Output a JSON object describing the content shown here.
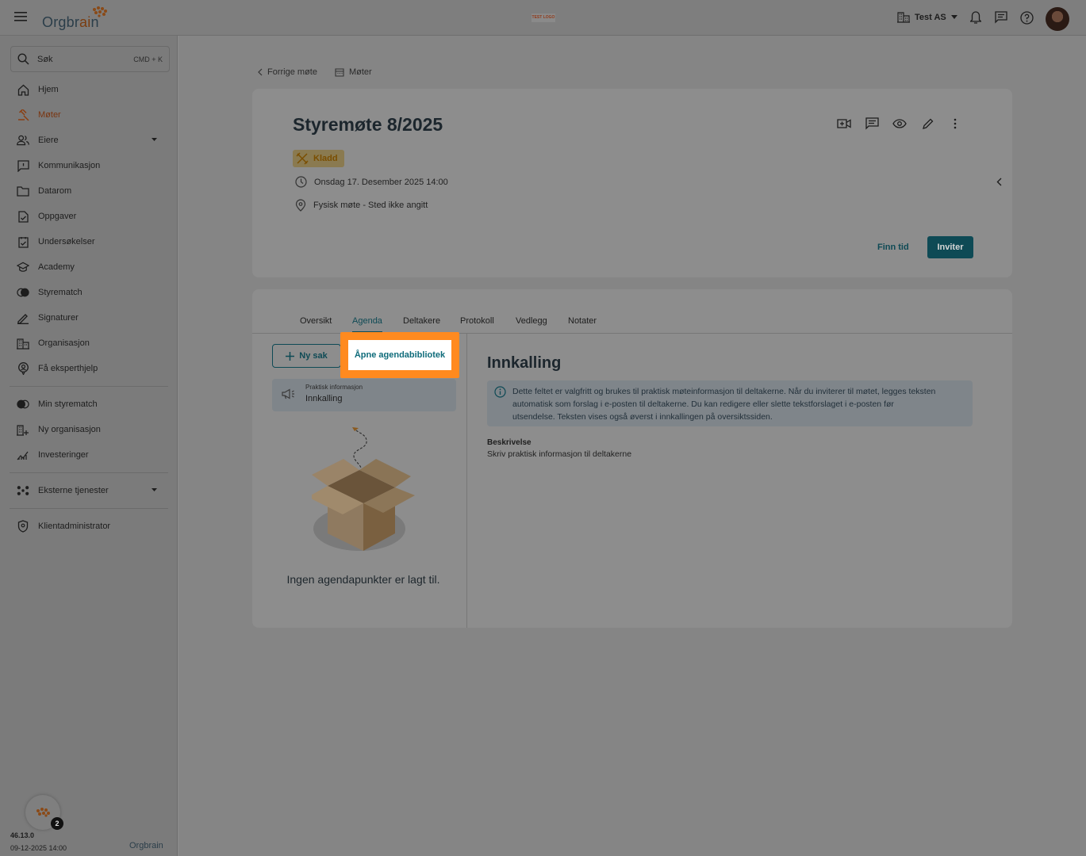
{
  "app": {
    "brand": "Orgbrain",
    "brand_left": "Orgbr",
    "brand_accent": "ai",
    "brand_right": "n",
    "test_logo": "TEST LOGO",
    "org_name": "Test AS"
  },
  "search": {
    "label": "Søk",
    "shortcut": "CMD + K"
  },
  "nav": {
    "items": [
      {
        "label": "Hjem",
        "icon": "home-icon"
      },
      {
        "label": "Møter",
        "icon": "gavel-icon"
      },
      {
        "label": "Eiere",
        "icon": "people-icon"
      },
      {
        "label": "Kommunikasjon",
        "icon": "chat-icon"
      },
      {
        "label": "Datarom",
        "icon": "folder-icon"
      },
      {
        "label": "Oppgaver",
        "icon": "task-icon"
      },
      {
        "label": "Undersøkelser",
        "icon": "survey-icon"
      },
      {
        "label": "Academy",
        "icon": "graduation-icon"
      },
      {
        "label": "Styrematch",
        "icon": "match-icon"
      },
      {
        "label": "Signaturer",
        "icon": "signature-icon"
      },
      {
        "label": "Organisasjon",
        "icon": "building-icon"
      },
      {
        "label": "Få eksperthjelp",
        "icon": "expert-icon"
      }
    ],
    "group2": [
      {
        "label": "Min styrematch",
        "icon": "match-icon"
      },
      {
        "label": "Ny organisasjon",
        "icon": "add-building-icon"
      },
      {
        "label": "Investeringer",
        "icon": "chart-icon"
      }
    ],
    "external": {
      "label": "Eksterne tjenester"
    },
    "admin": {
      "label": "Klientadministrator"
    }
  },
  "footer": {
    "version": "46.13.0",
    "datetime": "09-12-2025 14:00",
    "help_badge": "2"
  },
  "breadcrumb": {
    "back": "Forrige møte",
    "meetings": "Møter"
  },
  "meeting": {
    "title": "Styremøte 8/2025",
    "status": "Kladd",
    "date": "Onsdag 17. Desember 2025 14:00",
    "location": "Fysisk møte - Sted ikke angitt",
    "find_time": "Finn tid",
    "invite": "Inviter"
  },
  "tabs": [
    "Oversikt",
    "Agenda",
    "Deltakere",
    "Protokoll",
    "Vedlegg",
    "Notater"
  ],
  "agenda": {
    "new_item": "Ny sak",
    "open_library": "Åpne agendabibliotek",
    "item_category": "Praktisk informasjon",
    "item_name": "Innkalling",
    "empty_text": "Ingen agendapunkter er lagt til."
  },
  "detail": {
    "title": "Innkalling",
    "info_line1": "Dette feltet er valgfritt og brukes til praktisk møteinformasjon til deltakerne. Når du inviterer til møtet, legges teksten",
    "info_line2": "automatisk som forslag i e-posten til deltakerne. Du kan redigere eller slette tekstforslaget i e-posten før",
    "info_line3": "utsendelse. Teksten vises også øverst i innkallingen på oversiktssiden.",
    "desc_label": "Beskrivelse",
    "desc_text": "Skriv praktisk informasjon til deltakerne"
  },
  "colors": {
    "accent": "#0e4a55",
    "brand_orange": "#e07a20",
    "highlight": "#ff8a1f"
  }
}
